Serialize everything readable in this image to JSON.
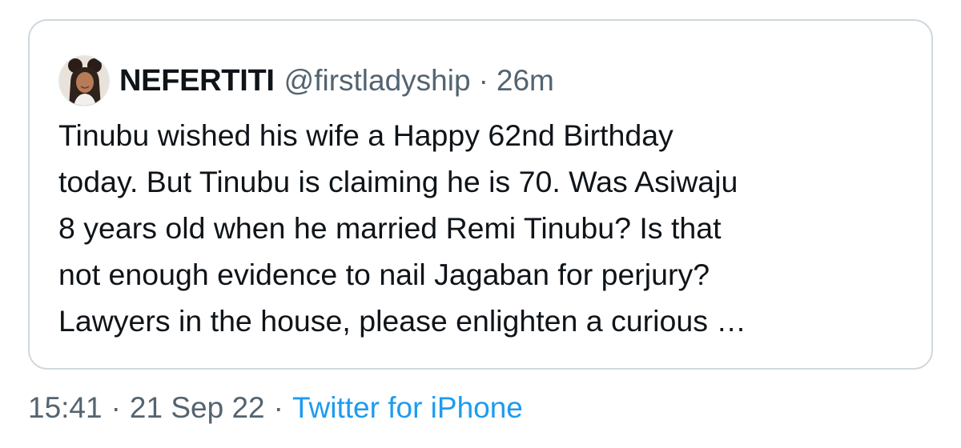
{
  "quoted_tweet": {
    "display_name": "NEFERTITI",
    "handle": "@firstladyship",
    "separator": "·",
    "relative_time": "26m",
    "text_lines": [
      "Tinubu wished his wife a Happy 62nd Birthday",
      "today. But Tinubu is claiming he is 70. Was Asiwaju",
      "8 years old when he married Remi Tinubu? Is that",
      "not enough evidence to nail Jagaban for perjury?",
      "Lawyers in the house, please enlighten a curious …"
    ]
  },
  "tweet_meta": {
    "time": "15:41",
    "separator": "·",
    "date": "21 Sep 22",
    "source": "Twitter for iPhone"
  },
  "colors": {
    "text_primary": "#0f1419",
    "text_secondary": "#536471",
    "link": "#1d9bf0",
    "border": "#cfd9de"
  },
  "icons": {
    "avatar": "profile-photo-avatar"
  }
}
